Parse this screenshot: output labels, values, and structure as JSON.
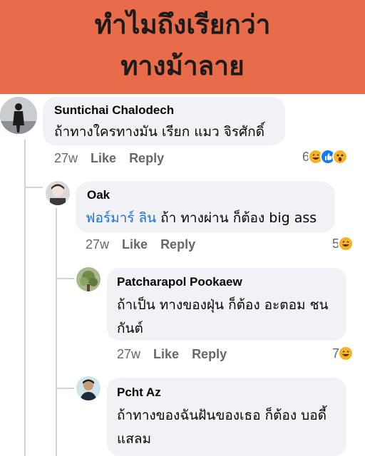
{
  "banner": {
    "line1": "ทำไมถึงเรียกว่า",
    "line2": "ทางม้าลาย"
  },
  "comments": [
    {
      "author": "Suntichai Chalodech",
      "lines": [
        "ถ้าทางใครทางมัน เรียก แมว จิรศักดิ์"
      ],
      "time": "27w",
      "like": "Like",
      "reply": "Reply",
      "reaction_count": "6",
      "reactions": [
        "haha-icon",
        "like-icon",
        "wow-icon"
      ]
    },
    {
      "author": "Oak",
      "mention": "ฟอร์มาร์ ลิน",
      "lines": [
        " ถ้า ทางผ่าน ก็ต้อง big ass"
      ],
      "time": "27w",
      "like": "Like",
      "reply": "Reply",
      "reaction_count": "5",
      "reactions": [
        "haha-icon"
      ]
    },
    {
      "author": "Patcharapol Pookaew",
      "lines": [
        "ถ้าเป็น ทางของฝุ่น ก็ต้อง อะตอม ชน",
        "กันต์"
      ],
      "time": "27w",
      "like": "Like",
      "reply": "Reply",
      "reaction_count": "7",
      "reactions": [
        "haha-icon"
      ]
    },
    {
      "author": "Pcht Az",
      "lines": [
        "ถ้าทางของฉันฝันของเธอ ก็ต้อง บอดี้",
        "แสลม"
      ]
    }
  ],
  "colors": {
    "banner": "#e86c4a",
    "bubble": "#f0f2f5",
    "mention": "#216fdb",
    "meta": "#65676b"
  }
}
